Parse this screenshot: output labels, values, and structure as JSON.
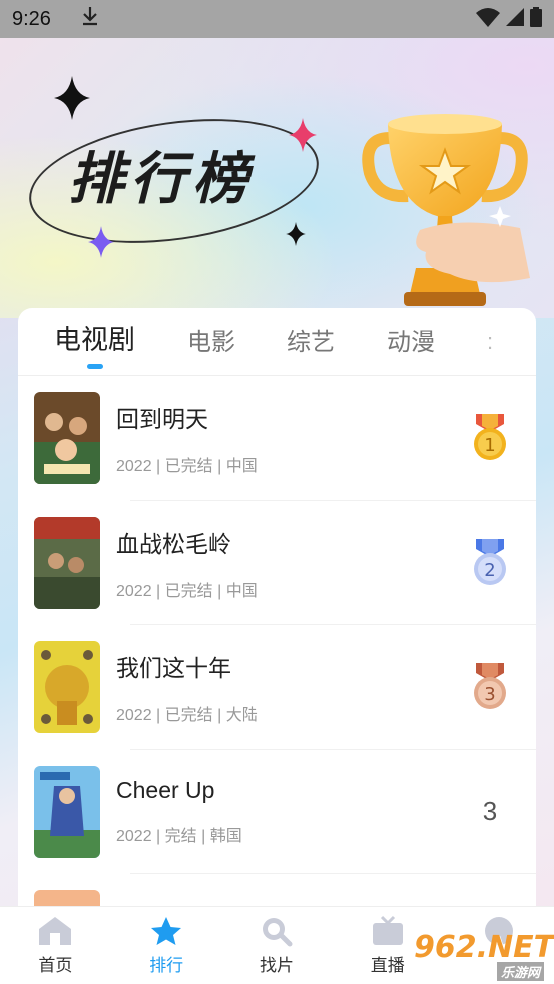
{
  "status_bar": {
    "time": "9:26"
  },
  "hero": {
    "title": "排行榜"
  },
  "tabs": [
    {
      "label": "电视剧",
      "active": true
    },
    {
      "label": "电影"
    },
    {
      "label": "综艺"
    },
    {
      "label": "动漫"
    }
  ],
  "ranking": [
    {
      "title": "回到明天",
      "meta": "2022 | 已完结 | 中国",
      "rank": "1",
      "badge": "gold-medal-icon"
    },
    {
      "title": "血战松毛岭",
      "meta": "2022 | 已完结 | 中国",
      "rank": "2",
      "badge": "silver-medal-icon"
    },
    {
      "title": "我们这十年",
      "meta": "2022 | 已完结 | 大陆",
      "rank": "3",
      "badge": "bronze-medal-icon"
    },
    {
      "title": "Cheer Up",
      "meta": "2022 | 完结 | 韩国",
      "rank": "3"
    }
  ],
  "nav": [
    {
      "label": "首页",
      "icon": "home-icon"
    },
    {
      "label": "排行",
      "icon": "star-icon",
      "active": true
    },
    {
      "label": "找片",
      "icon": "search-icon"
    },
    {
      "label": "直播",
      "icon": "tv-icon"
    },
    {
      "label": "我的",
      "icon": "profile-icon"
    }
  ],
  "watermark": {
    "main": "962.NET",
    "sub": "乐游网"
  },
  "colors": {
    "accent": "#1f9cf0",
    "gold": "#f2b21d",
    "silver": "#8ea6e8",
    "bronze": "#d98a63"
  }
}
